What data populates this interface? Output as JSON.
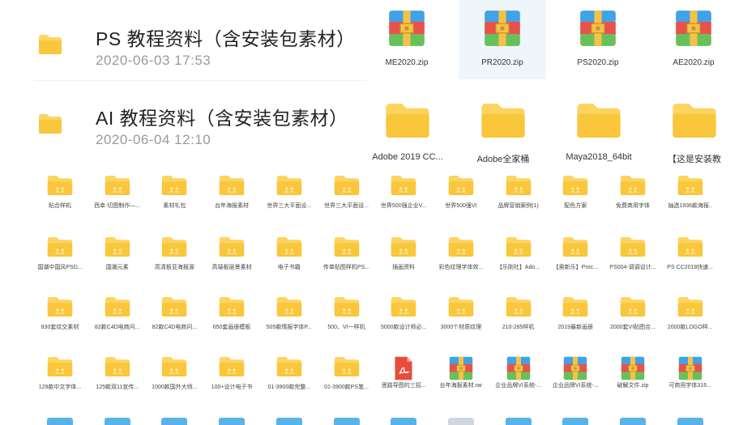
{
  "list_rows": [
    {
      "title": "PS 教程资料（含安装包素材）",
      "date": "2020-06-03 17:53"
    },
    {
      "title": "AI 教程资料（含安装包素材）",
      "date": "2020-06-04 12:10"
    }
  ],
  "zip_tiles": [
    {
      "label": "ME2020.zip",
      "selected": false
    },
    {
      "label": "PR2020.zip",
      "selected": true
    },
    {
      "label": "PS2020.zip",
      "selected": false
    },
    {
      "label": "AE2020.zip",
      "selected": false
    }
  ],
  "folder_tiles_large": [
    {
      "label": "Adobe 2019 CC..."
    },
    {
      "label": "Adobe全家桶"
    },
    {
      "label": "Maya2018_64bit"
    },
    {
      "label": "【这是安装教"
    }
  ],
  "small_grid": [
    [
      {
        "label": "贴合样机",
        "type": "folder"
      },
      {
        "label": "西幸·切图制作—...",
        "type": "folder"
      },
      {
        "label": "素材礼包",
        "type": "folder"
      },
      {
        "label": "台年海报素材",
        "type": "folder"
      },
      {
        "label": "世界三大平面设...",
        "type": "folder"
      },
      {
        "label": "世界三大平面设...",
        "type": "folder"
      },
      {
        "label": "世界500强企业V...",
        "type": "folder"
      },
      {
        "label": "世界500强VI",
        "type": "folder"
      },
      {
        "label": "品牌营销案例(1)",
        "type": "folder"
      },
      {
        "label": "配色方案",
        "type": "folder"
      },
      {
        "label": "免费商用字体",
        "type": "folder"
      },
      {
        "label": "抽选1936款海报..",
        "type": "folder"
      }
    ],
    [
      {
        "label": "国潮中国风PSD...",
        "type": "folder"
      },
      {
        "label": "国潮元素",
        "type": "folder"
      },
      {
        "label": "高清板亚海报源",
        "type": "folder"
      },
      {
        "label": "高端板层景素材",
        "type": "folder"
      },
      {
        "label": "电子书籍",
        "type": "folder"
      },
      {
        "label": "传单贴图样机PS...",
        "type": "folder"
      },
      {
        "label": "插画资料",
        "type": "folder"
      },
      {
        "label": "彩色纹理字体效...",
        "type": "folder"
      },
      {
        "label": "【乐刚社】Ado...",
        "type": "folder"
      },
      {
        "label": "【奥新乐】Proc...",
        "type": "folder"
      },
      {
        "label": "PS004-调调设计...",
        "type": "folder"
      },
      {
        "label": "PS CC2018快速...",
        "type": "folder"
      }
    ],
    [
      {
        "label": "830套纹交素材",
        "type": "folder"
      },
      {
        "label": "82款C4D电商问...",
        "type": "folder"
      },
      {
        "label": "82款C4D电商问...",
        "type": "folder"
      },
      {
        "label": "650套画册模板",
        "type": "folder"
      },
      {
        "label": "505款情报字体P...",
        "type": "folder"
      },
      {
        "label": "500、VI一样机",
        "type": "folder"
      },
      {
        "label": "5000款设计师必...",
        "type": "folder"
      },
      {
        "label": "3000个材质纹理",
        "type": "folder"
      },
      {
        "label": "210-285样机",
        "type": "folder"
      },
      {
        "label": "2019最新画册",
        "type": "folder"
      },
      {
        "label": "2000套VI贴图合...",
        "type": "folder"
      },
      {
        "label": "2000款LOGO样...",
        "type": "folder"
      }
    ],
    [
      {
        "label": "129款中文字体...",
        "type": "folder"
      },
      {
        "label": "125款双11宣传...",
        "type": "folder"
      },
      {
        "label": "1000款国外大师...",
        "type": "folder"
      },
      {
        "label": "100+设计电子书",
        "type": "folder"
      },
      {
        "label": "01-3900款完整...",
        "type": "folder"
      },
      {
        "label": "01-3900款PS笔...",
        "type": "folder"
      },
      {
        "label": "思路导图的三招...",
        "type": "pdf"
      },
      {
        "label": "台年海报素材.rar",
        "type": "zip"
      },
      {
        "label": "企业品牌VI系统-...",
        "type": "zip"
      },
      {
        "label": "企业品牌VI系统-...",
        "type": "zip"
      },
      {
        "label": "破解文件.zip",
        "type": "zip"
      },
      {
        "label": "可商用字体316...",
        "type": "zip"
      }
    ]
  ],
  "colors": {
    "folder_yellow": "#f9c63c",
    "folder_light": "#fcd96a",
    "selected_bg": "#eef6fc",
    "pdf_red": "#e74c3c"
  }
}
